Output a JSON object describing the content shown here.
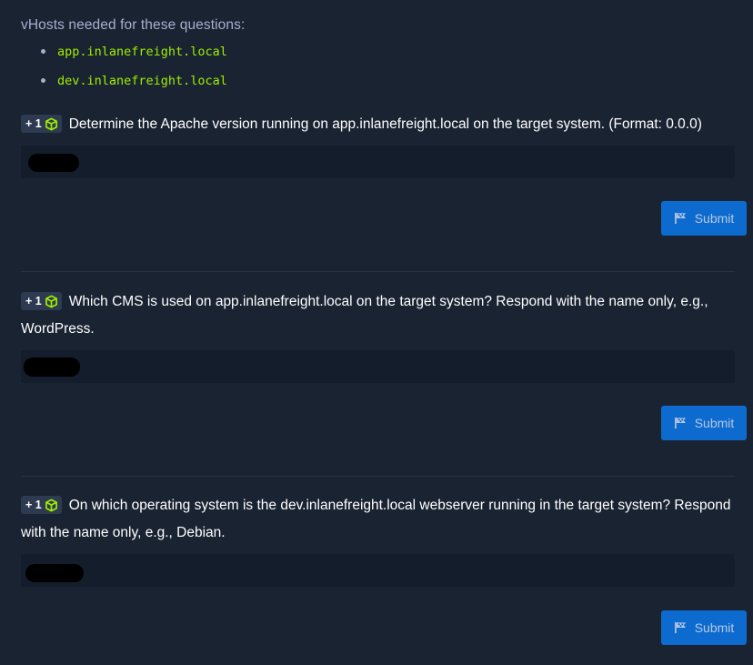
{
  "intro": {
    "text": "vHosts needed for these questions:",
    "vhosts": [
      "app.inlanefreight.local",
      "dev.inlanefreight.local"
    ]
  },
  "questions": [
    {
      "points": "+ 1",
      "text": "Determine the Apache version running on app.inlanefreight.local on the target system. (Format: 0.0.0)",
      "submit_label": "Submit"
    },
    {
      "points": "+ 1",
      "text": "Which CMS is used on app.inlanefreight.local on the target system? Respond with the name only, e.g., WordPress.",
      "submit_label": "Submit"
    },
    {
      "points": "+ 1",
      "text": "On which operating system is the dev.inlanefreight.local webserver running in the target system? Respond with the name only, e.g., Debian.",
      "submit_label": "Submit"
    }
  ],
  "icons": {
    "points": "cube-icon",
    "submit": "flag-icon"
  },
  "colors": {
    "background": "#1a2332",
    "accent_green": "#9fef00",
    "button_blue": "#0d6bd0",
    "input_bg": "#141d2b"
  }
}
